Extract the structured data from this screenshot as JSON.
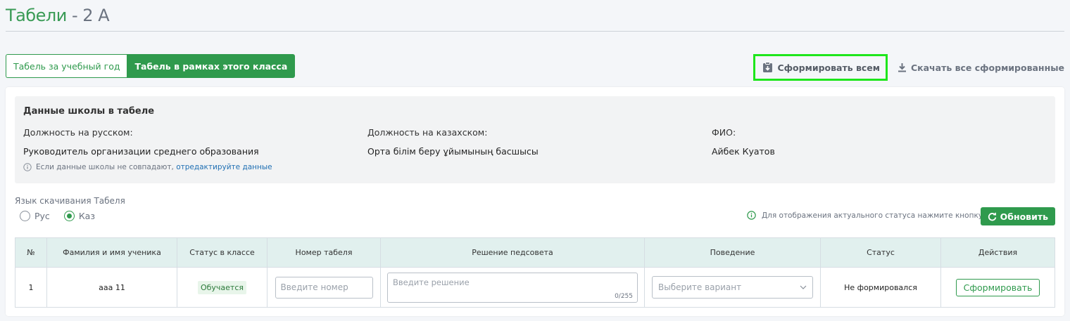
{
  "page": {
    "title": "Табели",
    "title_suffix": " - 2 А"
  },
  "tabs": [
    {
      "label": "Табель за учебный год",
      "active": false
    },
    {
      "label": "Табель в рамках этого класса",
      "active": true
    }
  ],
  "toolbar": {
    "form_all_label": "Сформировать всем",
    "download_all_label": "Скачать все сформированные"
  },
  "school_info": {
    "title": "Данные школы в табеле",
    "fields": [
      {
        "label": "Должность на русском:",
        "value": "Руководитель организации среднего образования"
      },
      {
        "label": "Должность на казахском:",
        "value": "Орта білім беру ұйымының басшысы"
      },
      {
        "label": "ФИО:",
        "value": "Айбек Куатов"
      }
    ],
    "note_text": "Если данные школы не совпадают, ",
    "note_link": "отредактируйте данные"
  },
  "language": {
    "label": "Язык скачивания Табеля",
    "options": [
      {
        "label": "Рус",
        "checked": false
      },
      {
        "label": "Каз",
        "checked": true
      }
    ]
  },
  "status_hint": "Для отображения актуального статуса нажмите кнопку",
  "refresh_label": "Обновить",
  "table": {
    "headers": [
      "№",
      "Фамилия и имя ученика",
      "Статус в классе",
      "Номер табеля",
      "Решение педсовета",
      "Поведение",
      "Статус",
      "Действия"
    ],
    "rows": [
      {
        "num": "1",
        "name": "ааа 11",
        "class_status": "Обучается",
        "number_placeholder": "Введите номер",
        "decision_placeholder": "Введите решение",
        "decision_counter": "0/255",
        "behavior_placeholder": "Выберите вариант",
        "status": "Не формировался",
        "action_label": "Сформировать"
      }
    ]
  },
  "colors": {
    "primary": "#2f9a4d",
    "title": "#3a9b56",
    "highlight_border": "#1ee61c",
    "table_header_bg": "#e1f0ee",
    "link": "#1f6fb3"
  },
  "icons": {
    "form_all": "clipboard-download-icon",
    "download_all": "download-icon",
    "info": "info-icon",
    "refresh": "refresh-icon",
    "chevron": "chevron-down-icon"
  }
}
